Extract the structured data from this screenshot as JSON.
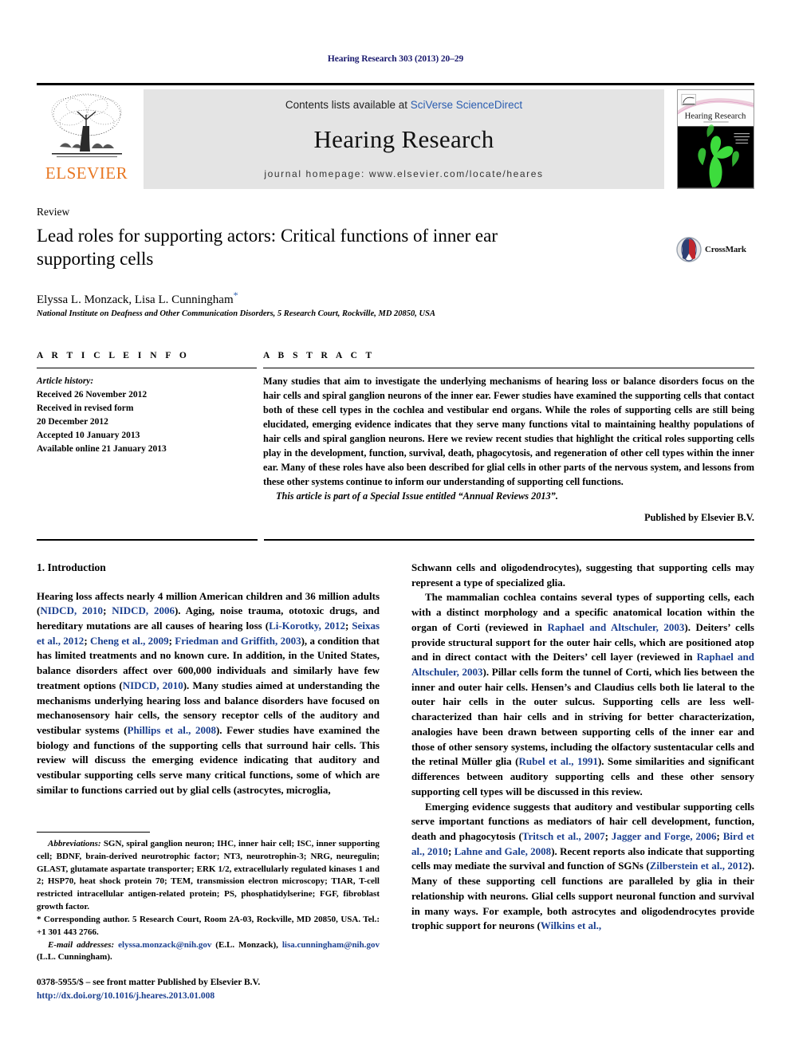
{
  "running_head": "Hearing Research 303 (2013) 20–29",
  "masthead": {
    "publisher_name": "ELSEVIER",
    "contents_prefix": "Contents lists available at ",
    "contents_link": "SciVerse ScienceDirect",
    "journal_name": "Hearing Research",
    "homepage_label": "journal homepage: www.elsevier.com/locate/heares",
    "cover_title": "Hearing Research"
  },
  "article": {
    "doctype": "Review",
    "title": "Lead roles for supporting actors: Critical functions of inner ear supporting cells",
    "authors": "Elyssa L. Monzack, Lisa L. Cunningham",
    "corresponding_marker": "*",
    "affiliation": "National Institute on Deafness and Other Communication Disorders, 5 Research Court, Rockville, MD 20850, USA",
    "crossmark_label": "CrossMark"
  },
  "info": {
    "heading": "A R T I C L E  I N F O",
    "history_label": "Article history:",
    "history": [
      "Received 26 November 2012",
      "Received in revised form",
      "20 December 2012",
      "Accepted 10 January 2013",
      "Available online 21 January 2013"
    ]
  },
  "abstract": {
    "heading": "A B S T R A C T",
    "text": "Many studies that aim to investigate the underlying mechanisms of hearing loss or balance disorders focus on the hair cells and spiral ganglion neurons of the inner ear. Fewer studies have examined the supporting cells that contact both of these cell types in the cochlea and vestibular end organs. While the roles of supporting cells are still being elucidated, emerging evidence indicates that they serve many functions vital to maintaining healthy populations of hair cells and spiral ganglion neurons. Here we review recent studies that highlight the critical roles supporting cells play in the development, function, survival, death, phagocytosis, and regeneration of other cell types within the inner ear. Many of these roles have also been described for glial cells in other parts of the nervous system, and lessons from these other systems continue to inform our understanding of supporting cell functions.",
    "special_issue": "This article is part of a Special Issue entitled “Annual Reviews 2013”.",
    "published_by": "Published by Elsevier B.V."
  },
  "body": {
    "section_heading": "1. Introduction",
    "left_paragraphs": [
      {
        "runs": [
          {
            "t": "Hearing loss affects nearly 4 million American children and 36 million adults ("
          },
          {
            "t": "NIDCD, 2010",
            "cite": true
          },
          {
            "t": "; "
          },
          {
            "t": "NIDCD, 2006",
            "cite": true
          },
          {
            "t": "). Aging, noise trauma, ototoxic drugs, and hereditary mutations are all causes of hearing loss ("
          },
          {
            "t": "Li-Korotky, 2012",
            "cite": true
          },
          {
            "t": "; "
          },
          {
            "t": "Seixas et al., 2012",
            "cite": true
          },
          {
            "t": "; "
          },
          {
            "t": "Cheng et al., 2009",
            "cite": true
          },
          {
            "t": "; "
          },
          {
            "t": "Friedman and Griffith, 2003",
            "cite": true
          },
          {
            "t": "), a condition that has limited treatments and no known cure. In addition, in the United States, balance disorders affect over 600,000 individuals and similarly have few treatment options ("
          },
          {
            "t": "NIDCD, 2010",
            "cite": true
          },
          {
            "t": "). Many studies aimed at understanding the mechanisms underlying hearing loss and balance disorders have focused on mechanosensory hair cells, the sensory receptor cells of the auditory and vestibular systems ("
          },
          {
            "t": "Phillips et al., 2008",
            "cite": true
          },
          {
            "t": "). Fewer studies have examined the biology and functions of the supporting cells that surround hair cells. This review will discuss the emerging evidence indicating that auditory and vestibular supporting cells serve many critical functions, some of which are similar to functions carried out by glial cells (astrocytes, microglia,"
          }
        ]
      }
    ],
    "right_paragraphs": [
      {
        "runs": [
          {
            "t": "Schwann cells and oligodendrocytes), suggesting that supporting cells may represent a type of specialized glia."
          }
        ]
      },
      {
        "indent": true,
        "runs": [
          {
            "t": "The mammalian cochlea contains several types of supporting cells, each with a distinct morphology and a specific anatomical location within the organ of Corti (reviewed in "
          },
          {
            "t": "Raphael and Altschuler, 2003",
            "cite": true
          },
          {
            "t": "). Deiters’ cells provide structural support for the outer hair cells, which are positioned atop and in direct contact with the Deiters’ cell layer (reviewed in "
          },
          {
            "t": "Raphael and Altschuler, 2003",
            "cite": true
          },
          {
            "t": "). Pillar cells form the tunnel of Corti, which lies between the inner and outer hair cells. Hensen’s and Claudius cells both lie lateral to the outer hair cells in the outer sulcus. Supporting cells are less well-characterized than hair cells and in striving for better characterization, analogies have been drawn between supporting cells of the inner ear and those of other sensory systems, including the olfactory sustentacular cells and the retinal Müller glia ("
          },
          {
            "t": "Rubel et al., 1991",
            "cite": true
          },
          {
            "t": "). Some similarities and significant differences between auditory supporting cells and these other sensory supporting cell types will be discussed in this review."
          }
        ]
      },
      {
        "indent": true,
        "runs": [
          {
            "t": "Emerging evidence suggests that auditory and vestibular supporting cells serve important functions as mediators of hair cell development, function, death and phagocytosis ("
          },
          {
            "t": "Tritsch et al., 2007",
            "cite": true
          },
          {
            "t": "; "
          },
          {
            "t": "Jagger and Forge, 2006",
            "cite": true
          },
          {
            "t": "; "
          },
          {
            "t": "Bird et al., 2010",
            "cite": true
          },
          {
            "t": "; "
          },
          {
            "t": "Lahne and Gale, 2008",
            "cite": true
          },
          {
            "t": "). Recent reports also indicate that supporting cells may mediate the survival and function of SGNs ("
          },
          {
            "t": "Zilberstein et al., 2012",
            "cite": true
          },
          {
            "t": "). Many of these supporting cell functions are paralleled by glia in their relationship with neurons. Glial cells support neuronal function and survival in many ways. For example, both astrocytes and oligodendrocytes provide trophic support for neurons ("
          },
          {
            "t": "Wilkins et al.,",
            "cite": true
          }
        ]
      }
    ]
  },
  "footnotes": {
    "abbreviations_label": "Abbreviations:",
    "abbreviations_text": " SGN, spiral ganglion neuron; IHC, inner hair cell; ISC, inner supporting cell; BDNF, brain-derived neurotrophic factor; NT3, neurotrophin-3; NRG, neuregulin; GLAST, glutamate aspartate transporter; ERK 1/2, extracellularly regulated kinases 1 and 2; HSP70, heat shock protein 70; TEM, transmission electron microscopy; TIAR, T-cell restricted intracellular antigen-related protein; PS, phosphatidylserine; FGF, fibroblast growth factor.",
    "corresponding": "* Corresponding author. 5 Research Court, Room 2A-03, Rockville, MD 20850, USA. Tel.: +1 301 443 2766.",
    "email_label": "E-mail addresses:",
    "email_1": "elyssa.monzack@nih.gov",
    "email_1_owner": " (E.L. Monzack), ",
    "email_2": "lisa.cunningham@nih.gov",
    "email_2_owner": " (L.L. Cunningham)."
  },
  "imprint": {
    "issn_line": "0378-5955/$ – see front matter Published by Elsevier B.V.",
    "doi": "http://dx.doi.org/10.1016/j.heares.2013.01.008"
  },
  "colors": {
    "link_blue": "#2a5db0",
    "cite_blue": "#1b3f8f",
    "elsevier_orange": "#E87722",
    "band_grey": "#e4e4e4",
    "crossmark_red": "#c1272d"
  }
}
